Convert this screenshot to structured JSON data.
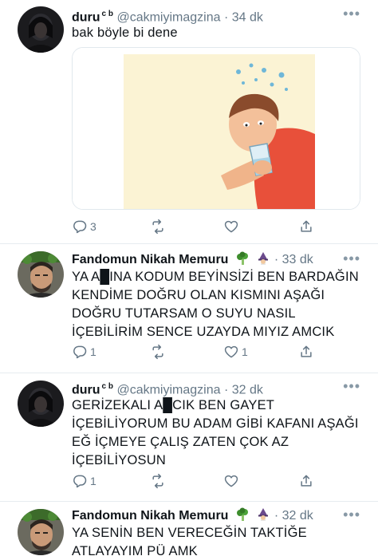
{
  "tweets": [
    {
      "author_name": "duru",
      "author_badge": "c b",
      "handle": "@cakmiyimagzina",
      "dot": "·",
      "time": "34 dk",
      "text": "bak böyle bi dene",
      "has_image": true,
      "reply_count": "3",
      "like_count": ""
    },
    {
      "author_name": "Fandomun Nikah Memuru",
      "author_badge": "",
      "handle": "",
      "dot": "·",
      "time": "33 dk",
      "text": "YA A█INA KODUM BEYİNSİZİ BEN BARDAĞIN KENDİME DOĞRU OLAN KISMINI AŞAĞI DOĞRU TUTARSAM O SUYU NASIL İÇEBİLİRİM SENCE UZAYDA MIYIZ AMCIK",
      "reply_count": "1",
      "like_count": "1"
    },
    {
      "author_name": "duru",
      "author_badge": "c b",
      "handle": "@cakmiyimagzina",
      "dot": "·",
      "time": "32 dk",
      "text": "GERİZEKALI A█CIK BEN GAYET İÇEBİLİYORUM BU ADAM GİBİ KAFANI AŞAĞI EĞ İÇMEYE ÇALIŞ ZATEN ÇOK AZ İÇEBİLİYOSUN",
      "reply_count": "1",
      "like_count": ""
    },
    {
      "author_name": "Fandomun Nikah Memuru",
      "author_badge": "",
      "handle": "",
      "dot": "·",
      "time": "32 dk",
      "text": "YA SENİN BEN VERECEĞİN TAKTİĞE ATLAYAYIM PÜ AMK"
    }
  ],
  "more_glyph": "•••",
  "colors": {
    "secondary_text": "#657786",
    "divider": "#e6ecf0",
    "image_background": "#fbf3d4",
    "shirt_red": "#e8503a"
  },
  "icons": [
    "reply-icon",
    "retweet-icon",
    "like-icon",
    "share-icon",
    "broccoli-emoji",
    "wizard-emoji"
  ]
}
